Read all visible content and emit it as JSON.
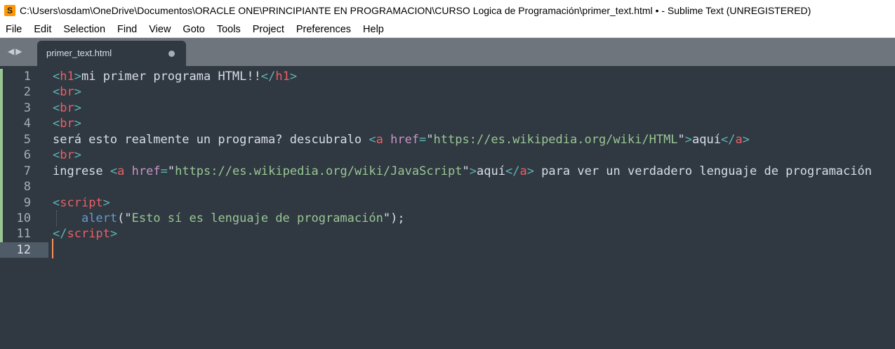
{
  "window": {
    "title": "C:\\Users\\osdam\\OneDrive\\Documentos\\ORACLE ONE\\PRINCIPIANTE EN PROGRAMACION\\CURSO Logica de Programación\\primer_text.html • - Sublime Text (UNREGISTERED)"
  },
  "menu": [
    "File",
    "Edit",
    "Selection",
    "Find",
    "View",
    "Goto",
    "Tools",
    "Project",
    "Preferences",
    "Help"
  ],
  "tab": {
    "label": "primer_text.html",
    "unsaved": true
  },
  "lines": [
    [
      [
        "p",
        "<"
      ],
      [
        "tag",
        "h1"
      ],
      [
        "p",
        ">"
      ],
      [
        "txt",
        "mi primer programa HTML!!"
      ],
      [
        "p",
        "</"
      ],
      [
        "tag",
        "h1"
      ],
      [
        "p",
        ">"
      ]
    ],
    [
      [
        "p",
        "<"
      ],
      [
        "tag",
        "br"
      ],
      [
        "p",
        ">"
      ]
    ],
    [
      [
        "p",
        "<"
      ],
      [
        "tag",
        "br"
      ],
      [
        "p",
        ">"
      ]
    ],
    [
      [
        "p",
        "<"
      ],
      [
        "tag",
        "br"
      ],
      [
        "p",
        ">"
      ]
    ],
    [
      [
        "txt",
        "será esto realmente un programa? descubralo "
      ],
      [
        "p",
        "<"
      ],
      [
        "tag",
        "a"
      ],
      [
        "txt",
        " "
      ],
      [
        "attr",
        "href"
      ],
      [
        "p",
        "="
      ],
      [
        "txt",
        "\""
      ],
      [
        "str",
        "https://es.wikipedia.org/wiki/HTML"
      ],
      [
        "txt",
        "\""
      ],
      [
        "p",
        ">"
      ],
      [
        "txt",
        "aquí"
      ],
      [
        "p",
        "</"
      ],
      [
        "tag",
        "a"
      ],
      [
        "p",
        ">"
      ]
    ],
    [
      [
        "p",
        "<"
      ],
      [
        "tag",
        "br"
      ],
      [
        "p",
        ">"
      ]
    ],
    [
      [
        "txt",
        "ingrese "
      ],
      [
        "p",
        "<"
      ],
      [
        "tag",
        "a"
      ],
      [
        "txt",
        " "
      ],
      [
        "attr",
        "href"
      ],
      [
        "p",
        "="
      ],
      [
        "txt",
        "\""
      ],
      [
        "str",
        "https://es.wikipedia.org/wiki/JavaScript"
      ],
      [
        "txt",
        "\""
      ],
      [
        "p",
        ">"
      ],
      [
        "txt",
        "aquí"
      ],
      [
        "p",
        "</"
      ],
      [
        "tag",
        "a"
      ],
      [
        "p",
        ">"
      ],
      [
        "txt",
        " para ver un verdadero lenguaje de programación"
      ]
    ],
    [],
    [
      [
        "p",
        "<"
      ],
      [
        "tag",
        "script"
      ],
      [
        "p",
        ">"
      ]
    ],
    [
      [
        "txt",
        "    "
      ],
      [
        "fn",
        "alert"
      ],
      [
        "txt",
        "(\""
      ],
      [
        "str",
        "Esto sí es lenguaje de programación"
      ],
      [
        "txt",
        "\");"
      ]
    ],
    [
      [
        "p",
        "</"
      ],
      [
        "tag",
        "script"
      ],
      [
        "p",
        ">"
      ]
    ],
    []
  ],
  "cursor_line": 12
}
